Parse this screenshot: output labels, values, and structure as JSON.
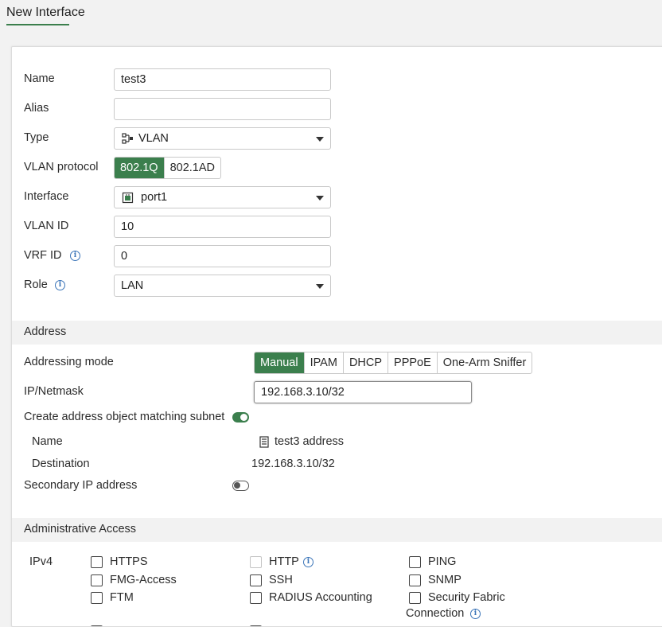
{
  "header": {
    "title": "New Interface"
  },
  "form": {
    "name": {
      "label": "Name",
      "value": "test3"
    },
    "alias": {
      "label": "Alias",
      "value": ""
    },
    "type": {
      "label": "Type",
      "value": "VLAN"
    },
    "vlan_protocol": {
      "label": "VLAN protocol",
      "options": [
        "802.1Q",
        "802.1AD"
      ],
      "selected": "802.1Q"
    },
    "interface": {
      "label": "Interface",
      "value": "port1"
    },
    "vlan_id": {
      "label": "VLAN ID",
      "value": "10"
    },
    "vrf_id": {
      "label": "VRF ID",
      "value": "0"
    },
    "role": {
      "label": "Role",
      "value": "LAN"
    }
  },
  "address": {
    "section_title": "Address",
    "addressing_mode": {
      "label": "Addressing mode",
      "options": [
        "Manual",
        "IPAM",
        "DHCP",
        "PPPoE",
        "One-Arm Sniffer"
      ],
      "selected": "Manual"
    },
    "ip_netmask": {
      "label": "IP/Netmask",
      "value": "192.168.3.10/32"
    },
    "create_object": {
      "label": "Create address object matching subnet",
      "enabled": true
    },
    "object_name": {
      "label": "Name",
      "value": "test3 address"
    },
    "destination": {
      "label": "Destination",
      "value": "192.168.3.10/32"
    },
    "secondary_ip": {
      "label": "Secondary IP address",
      "enabled": false
    }
  },
  "admin_access": {
    "section_title": "Administrative Access",
    "ipv4_label": "IPv4",
    "options": {
      "https": {
        "label": "HTTPS",
        "checked": false
      },
      "http": {
        "label": "HTTP",
        "checked": false,
        "disabled": true
      },
      "ping": {
        "label": "PING",
        "checked": false
      },
      "fmg_access": {
        "label": "FMG-Access",
        "checked": false
      },
      "ssh": {
        "label": "SSH",
        "checked": false
      },
      "snmp": {
        "label": "SNMP",
        "checked": false
      },
      "ftm": {
        "label": "FTM",
        "checked": false
      },
      "radius": {
        "label": "RADIUS Accounting",
        "checked": false
      },
      "security_fabric_1": "Security Fabric",
      "security_fabric_2": "Connection"
    }
  },
  "colors": {
    "accent": "#3b7f4d",
    "info": "#3a74b8",
    "section_bg": "#f2f2f2"
  }
}
